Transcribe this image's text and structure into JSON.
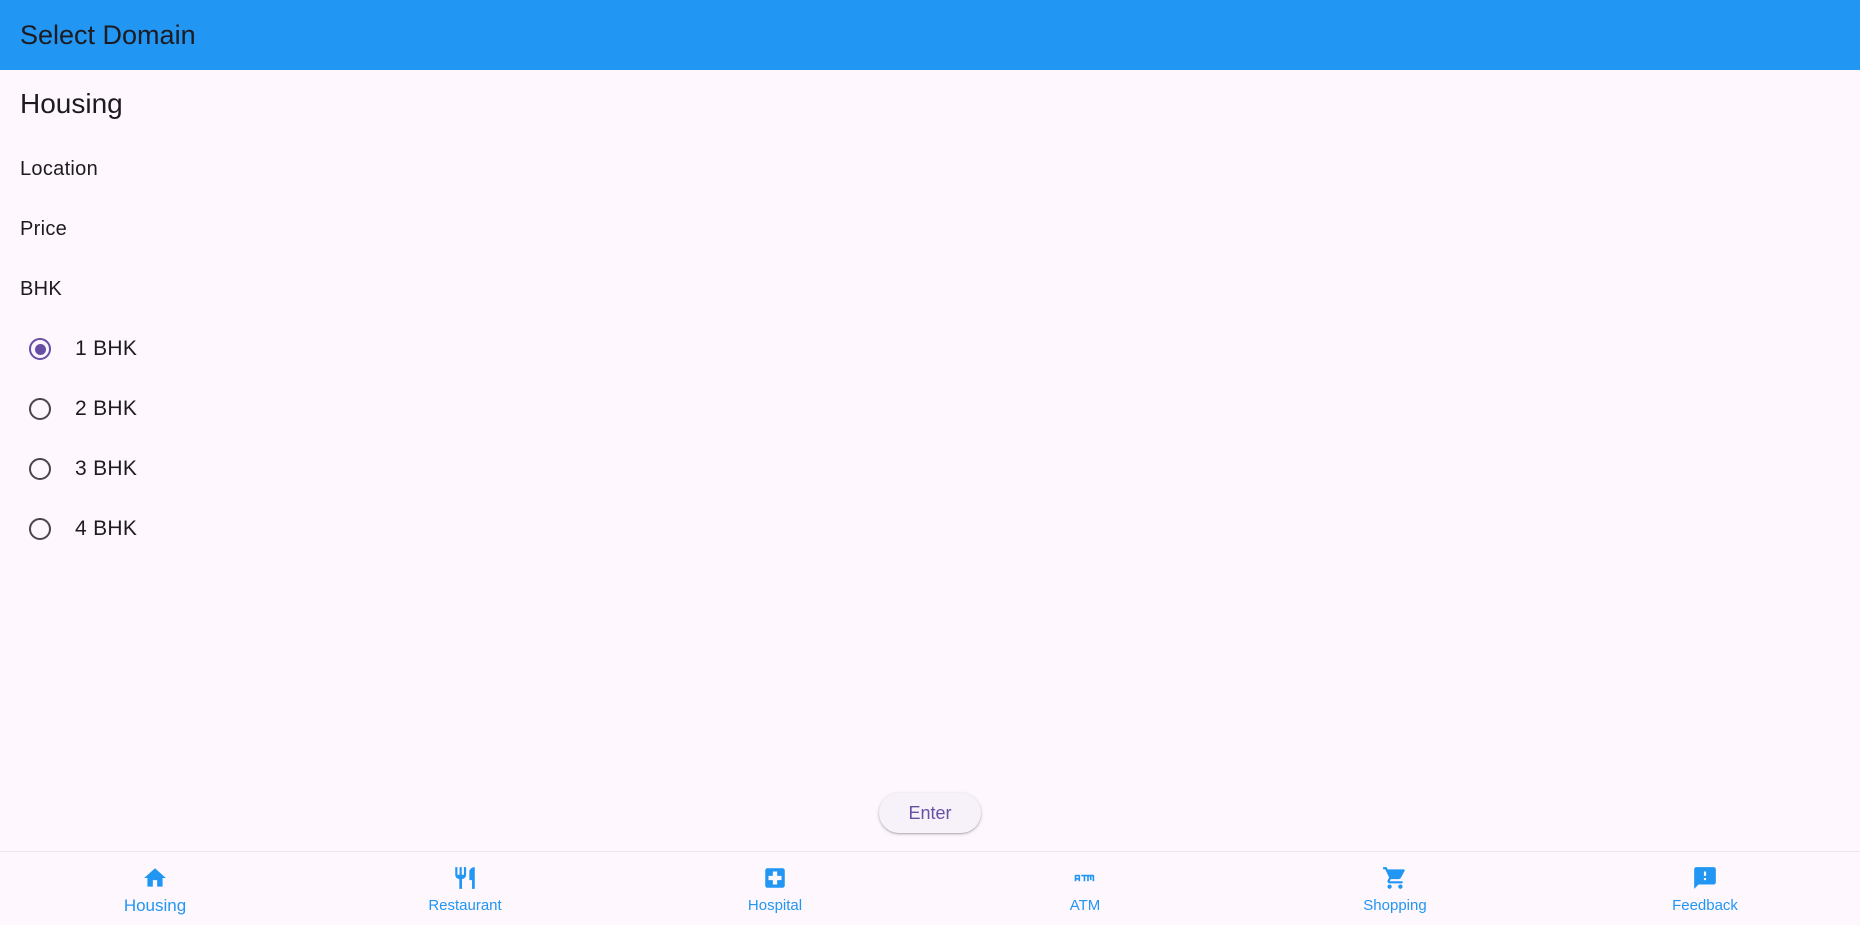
{
  "appbar": {
    "title": "Select Domain"
  },
  "form": {
    "title": "Housing",
    "location_label": "Location",
    "price_label": "Price",
    "bhk_label": "BHK",
    "bhk_options": [
      {
        "label": "1 BHK",
        "selected": true
      },
      {
        "label": "2 BHK",
        "selected": false
      },
      {
        "label": "3 BHK",
        "selected": false
      },
      {
        "label": "4 BHK",
        "selected": false
      }
    ],
    "enter_label": "Enter"
  },
  "bottom_nav": {
    "items": [
      {
        "label": "Housing",
        "icon": "home-icon",
        "active": true
      },
      {
        "label": "Restaurant",
        "icon": "restaurant-icon",
        "active": false
      },
      {
        "label": "Hospital",
        "icon": "hospital-icon",
        "active": false
      },
      {
        "label": "ATM",
        "icon": "atm-icon",
        "active": false
      },
      {
        "label": "Shopping",
        "icon": "shopping-cart-icon",
        "active": false
      },
      {
        "label": "Feedback",
        "icon": "feedback-icon",
        "active": false
      }
    ]
  },
  "colors": {
    "appbar": "#2196f3",
    "background": "#fff7fe",
    "accent": "#6750a4",
    "nav": "#2196f3"
  }
}
